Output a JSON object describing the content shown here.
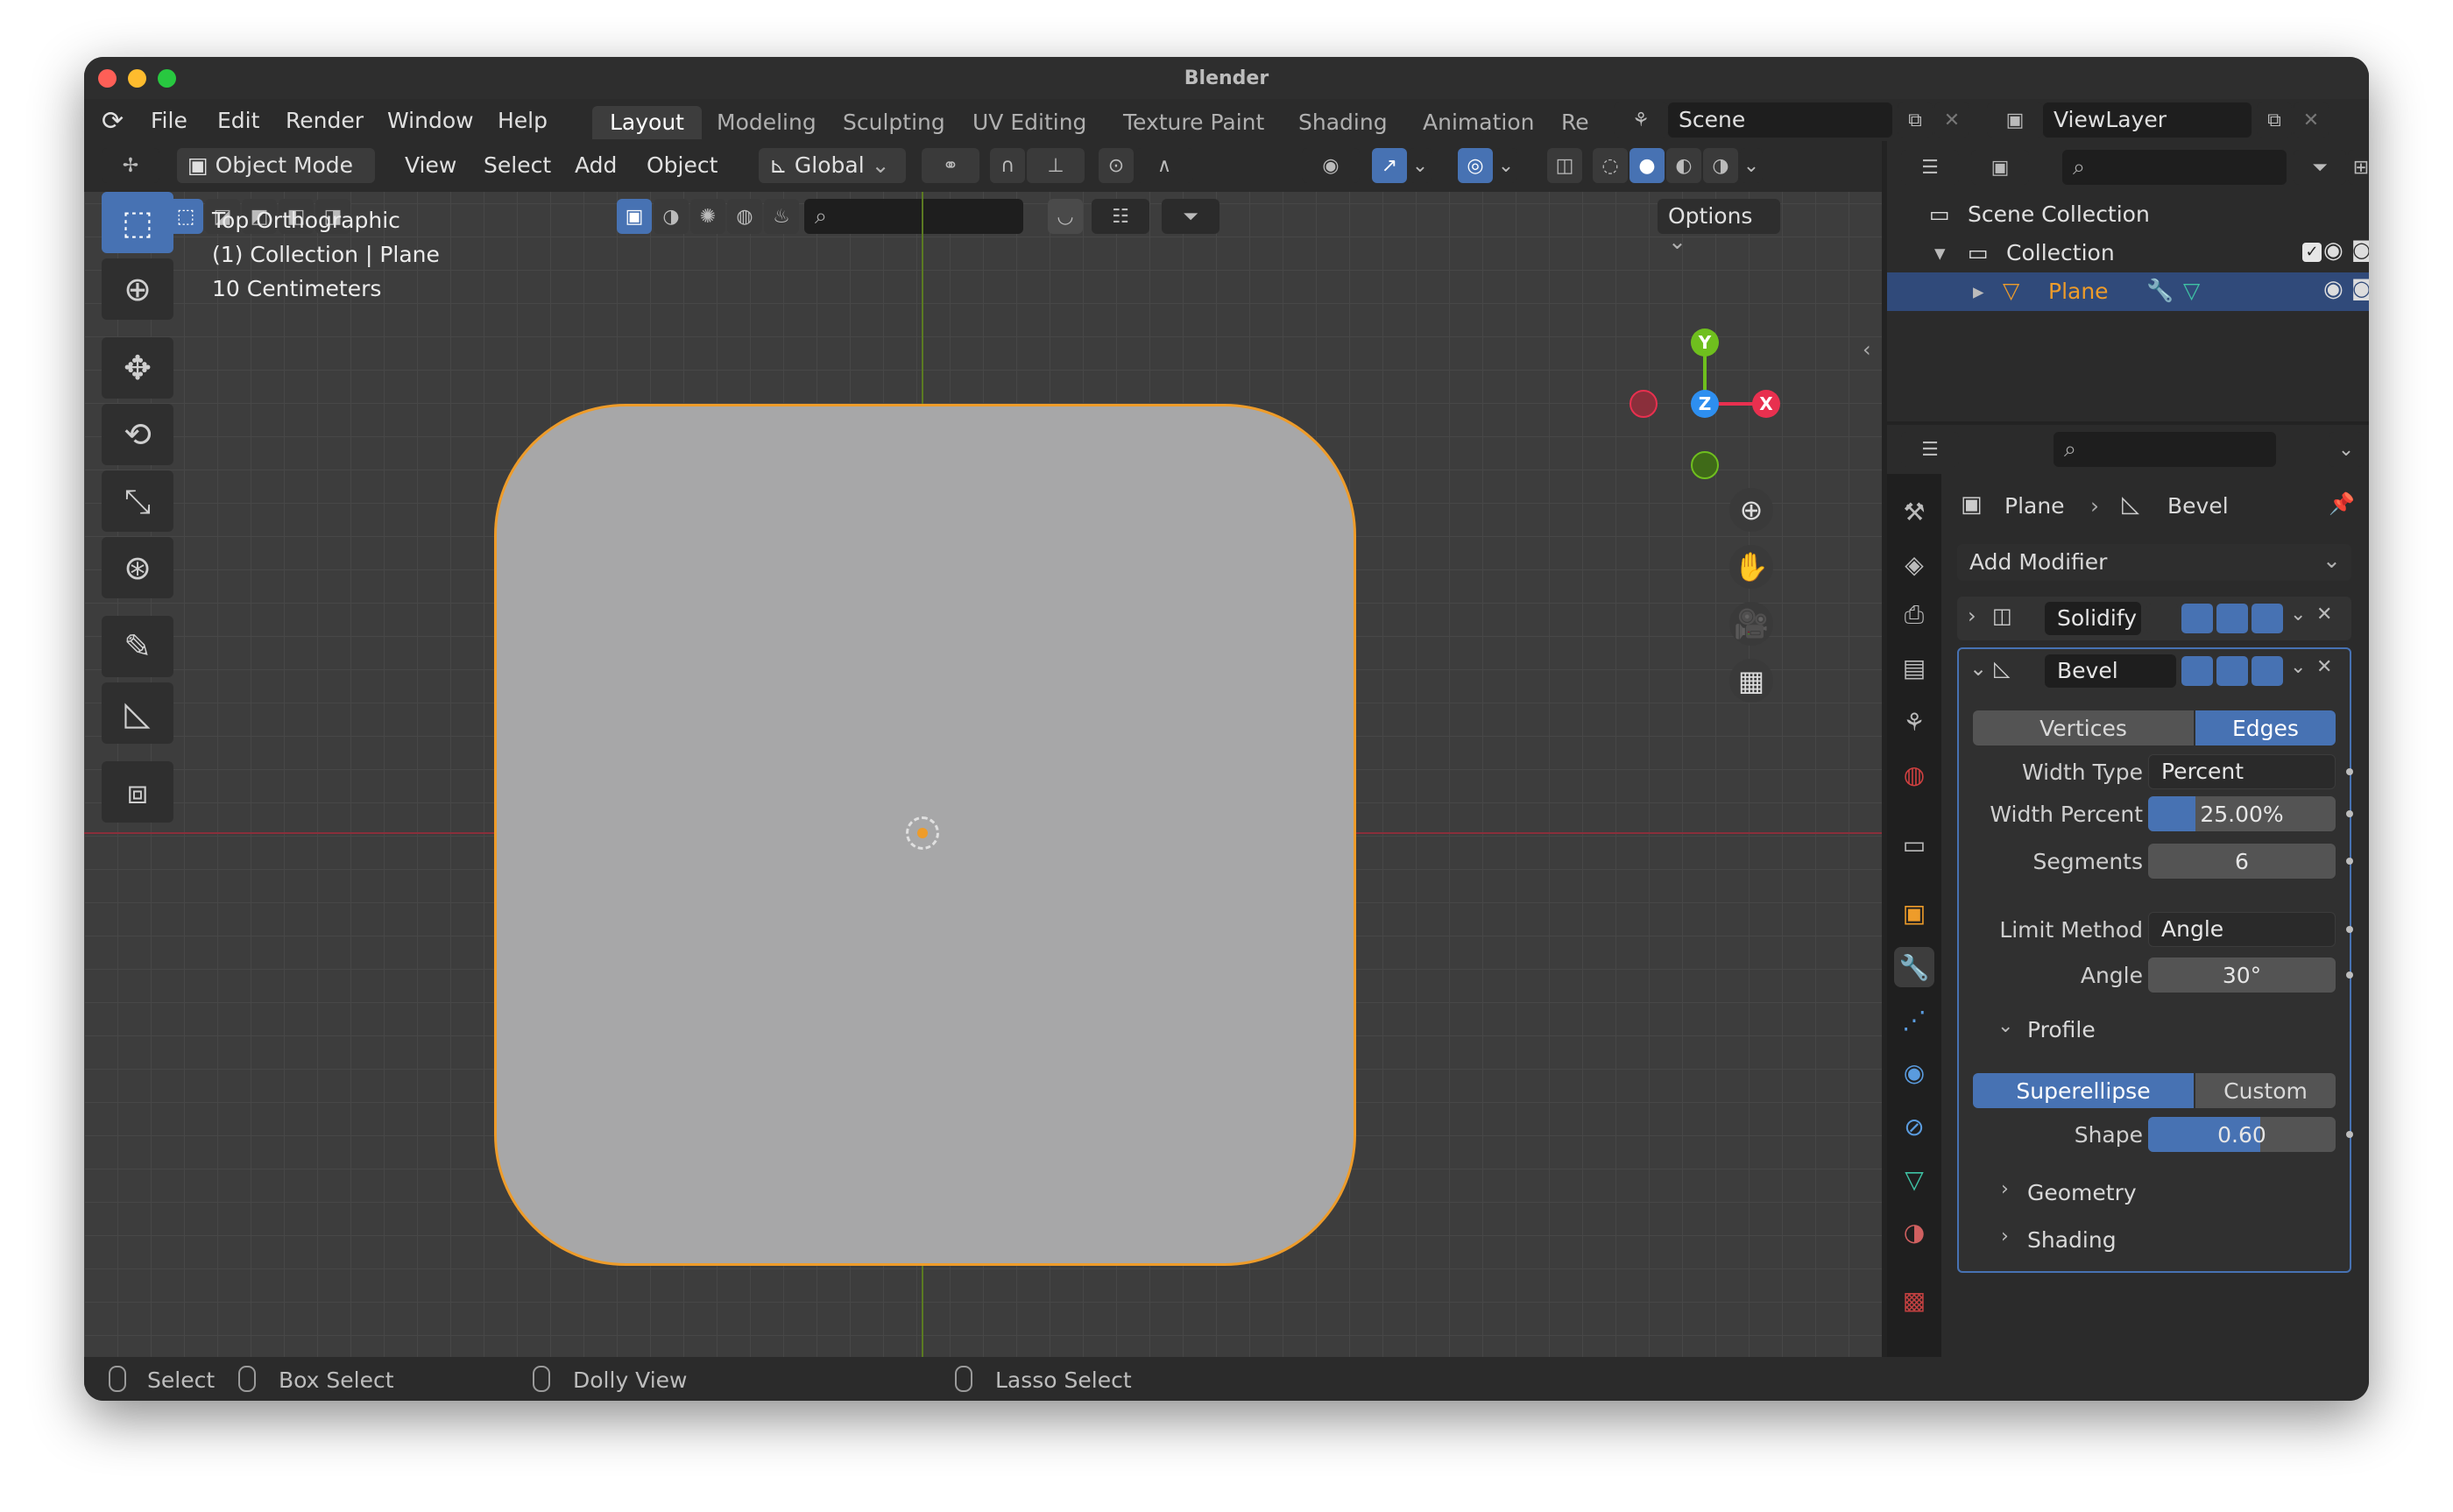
{
  "window": {
    "title": "Blender"
  },
  "menu": {
    "items": [
      "File",
      "Edit",
      "Render",
      "Window",
      "Help"
    ]
  },
  "workspaces": [
    "Layout",
    "Modeling",
    "Sculpting",
    "UV Editing",
    "Texture Paint",
    "Shading",
    "Animation",
    "Re"
  ],
  "scene": {
    "name": "Scene",
    "view_layer": "ViewLayer"
  },
  "viewport_header": {
    "mode": "Object Mode",
    "menus": [
      "View",
      "Select",
      "Add",
      "Object"
    ],
    "orientation": "Global",
    "options": "Options"
  },
  "viewport": {
    "view_name": "Top Orthographic",
    "collection_info": "(1) Collection | Plane",
    "scale": "10 Centimeters",
    "gizmo": {
      "y": "Y",
      "z": "Z",
      "x": "X"
    }
  },
  "statusbar": {
    "select": "Select",
    "box_select": "Box Select",
    "dolly": "Dolly View",
    "lasso": "Lasso Select"
  },
  "outliner": {
    "scene_collection": "Scene Collection",
    "collection": "Collection",
    "object": "Plane"
  },
  "properties": {
    "breadcrumb_object": "Plane",
    "breadcrumb_modifier": "Bevel",
    "add_modifier": "Add Modifier",
    "modifiers": [
      {
        "name": "Solidify",
        "expanded": false
      },
      {
        "name": "Bevel",
        "expanded": true
      }
    ],
    "bevel": {
      "affect_options": [
        "Vertices",
        "Edges"
      ],
      "affect_selected": "Edges",
      "width_type_label": "Width Type",
      "width_type": "Percent",
      "width_percent_label": "Width Percent",
      "width_percent": "25.00%",
      "width_percent_fill": 0.25,
      "segments_label": "Segments",
      "segments": "6",
      "limit_method_label": "Limit Method",
      "limit_method": "Angle",
      "angle_label": "Angle",
      "angle": "30°",
      "profile_label": "Profile",
      "profile_options": [
        "Superellipse",
        "Custom"
      ],
      "profile_selected": "Superellipse",
      "shape_label": "Shape",
      "shape": "0.60",
      "shape_fill": 0.6,
      "geometry_label": "Geometry",
      "shading_label": "Shading"
    }
  },
  "colors": {
    "accent": "#4772b3",
    "selection_outline": "#ee9c2a",
    "x_axis": "#e8304f",
    "y_axis": "#6fbf1e",
    "z_axis": "#2e8ff0"
  }
}
